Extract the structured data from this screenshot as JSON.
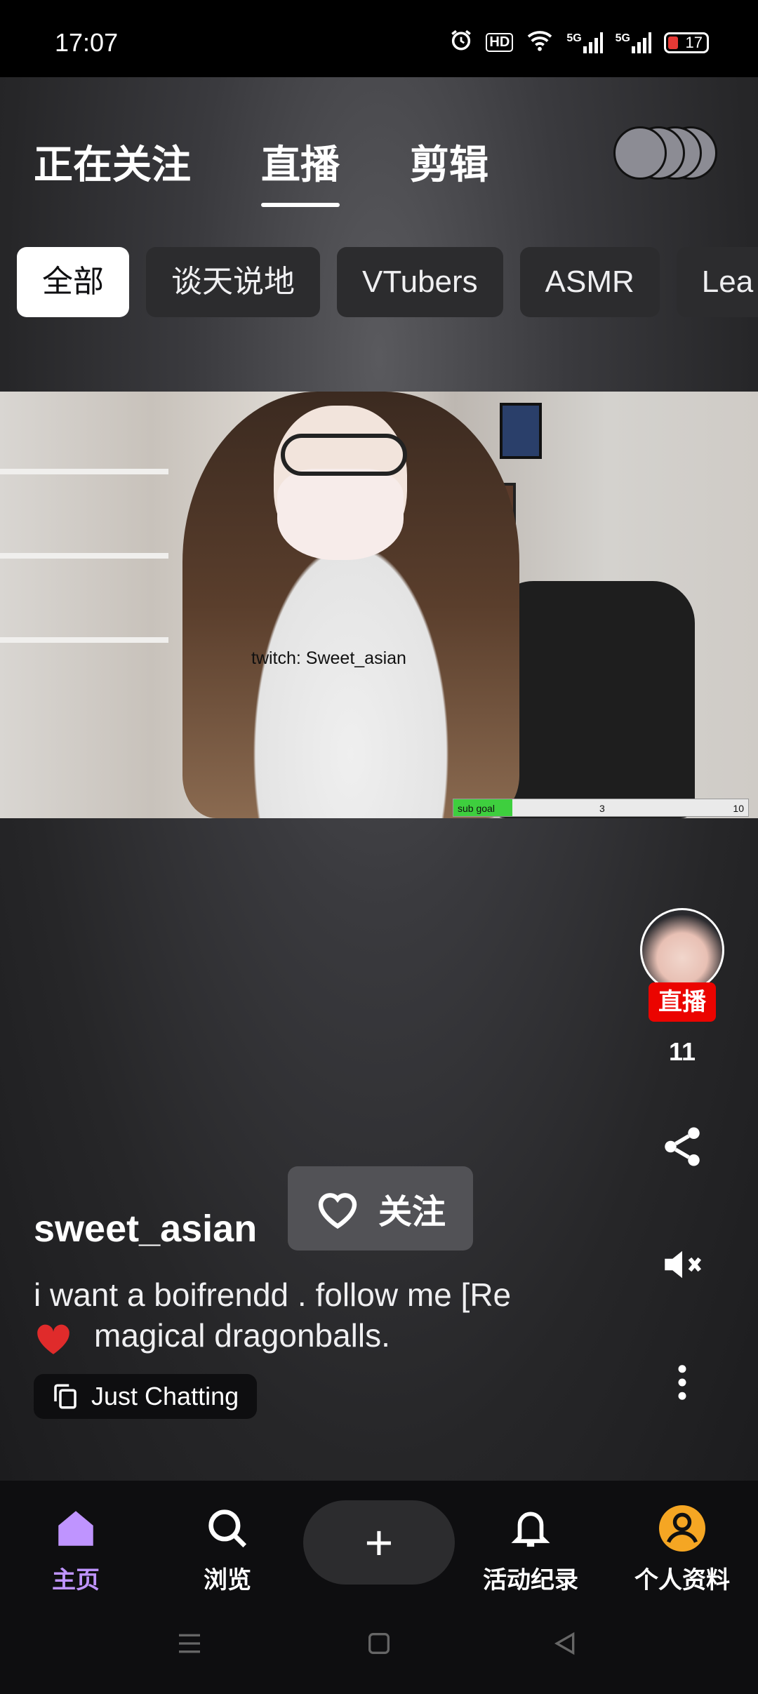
{
  "status": {
    "time": "17:07",
    "hd": "HD",
    "net1": "5G",
    "net2": "5G",
    "battery": "17"
  },
  "top_tabs": [
    {
      "label": "正在关注"
    },
    {
      "label": "直播"
    },
    {
      "label": "剪辑"
    }
  ],
  "chips": [
    {
      "label": "全部"
    },
    {
      "label": "谈天说地"
    },
    {
      "label": "VTubers"
    },
    {
      "label": "ASMR"
    },
    {
      "label": "Lea"
    }
  ],
  "video": {
    "overlay_text": "twitch: Sweet_asian",
    "sub_goal": {
      "label": "sub goal",
      "current": "3",
      "max": "10",
      "progress": 0.2
    }
  },
  "rail": {
    "live_badge": "直播",
    "viewers": "11"
  },
  "stream": {
    "streamer": "sweet_asian",
    "follow_label": "关注",
    "title_line1": "i want a boifrendd . follow me [Re",
    "title_line2": "magical dragonballs.",
    "category": "Just Chatting"
  },
  "nav": {
    "home": "主页",
    "browse": "浏览",
    "create": "+",
    "activity": "活动纪录",
    "profile": "个人资料"
  },
  "colors": {
    "accent": "#bf94ff",
    "live": "#eb0400",
    "profile_avatar": "#f5a623"
  }
}
